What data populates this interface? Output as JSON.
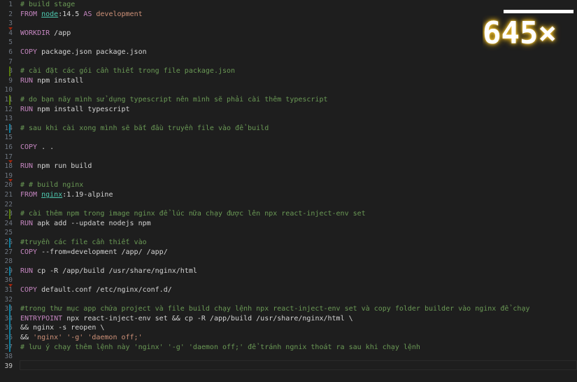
{
  "editor": {
    "lines": [
      {
        "n": "1",
        "parts": [
          {
            "t": "# build stage",
            "c": "comment"
          }
        ]
      },
      {
        "n": "2",
        "parts": [
          {
            "t": "FROM ",
            "c": "kw"
          },
          {
            "t": "node",
            "c": "img"
          },
          {
            "t": ":14.5 ",
            "c": "op"
          },
          {
            "t": "AS ",
            "c": "kw"
          },
          {
            "t": "development",
            "c": "str"
          }
        ]
      },
      {
        "n": "3",
        "parts": []
      },
      {
        "n": "4",
        "parts": [
          {
            "t": "WORKDIR ",
            "c": "kw"
          },
          {
            "t": "/app",
            "c": "op"
          }
        ]
      },
      {
        "n": "5",
        "parts": []
      },
      {
        "n": "6",
        "parts": [
          {
            "t": "COPY ",
            "c": "kw"
          },
          {
            "t": "package.json package.json",
            "c": "op"
          }
        ]
      },
      {
        "n": "7",
        "parts": []
      },
      {
        "n": "8",
        "parts": [
          {
            "t": "# cài đặt các gói cần thiết trong file package.json",
            "c": "comment"
          }
        ]
      },
      {
        "n": "9",
        "parts": [
          {
            "t": "RUN ",
            "c": "kw"
          },
          {
            "t": "npm install",
            "c": "op"
          }
        ]
      },
      {
        "n": "10",
        "parts": []
      },
      {
        "n": "11",
        "parts": [
          {
            "t": "# do bạn nãy mình sử dụng typescript nên mình sẽ phải cài thêm typescript",
            "c": "comment"
          }
        ]
      },
      {
        "n": "12",
        "parts": [
          {
            "t": "RUN ",
            "c": "kw"
          },
          {
            "t": "npm install typescript",
            "c": "op"
          }
        ]
      },
      {
        "n": "13",
        "parts": []
      },
      {
        "n": "14",
        "parts": [
          {
            "t": "# sau khi cài xong mình sẽ bắt đầu truyền file vào để build",
            "c": "comment"
          }
        ]
      },
      {
        "n": "15",
        "parts": []
      },
      {
        "n": "16",
        "parts": [
          {
            "t": "COPY ",
            "c": "kw"
          },
          {
            "t": ". .",
            "c": "op"
          }
        ]
      },
      {
        "n": "17",
        "parts": []
      },
      {
        "n": "18",
        "parts": [
          {
            "t": "RUN ",
            "c": "kw"
          },
          {
            "t": "npm run build",
            "c": "op"
          }
        ]
      },
      {
        "n": "19",
        "parts": []
      },
      {
        "n": "20",
        "parts": [
          {
            "t": "# # build nginx",
            "c": "comment"
          }
        ]
      },
      {
        "n": "21",
        "parts": [
          {
            "t": "FROM ",
            "c": "kw"
          },
          {
            "t": "nginx",
            "c": "img"
          },
          {
            "t": ":1.19-alpine",
            "c": "op"
          }
        ]
      },
      {
        "n": "22",
        "parts": []
      },
      {
        "n": "23",
        "parts": [
          {
            "t": "# cài thêm npm trong image nginx để lúc nữa chạy được lên npx react-inject-env set",
            "c": "comment"
          }
        ]
      },
      {
        "n": "24",
        "parts": [
          {
            "t": "RUN ",
            "c": "kw"
          },
          {
            "t": "apk add --update nodejs npm",
            "c": "op"
          }
        ]
      },
      {
        "n": "25",
        "parts": []
      },
      {
        "n": "26",
        "parts": [
          {
            "t": "#truyền các file cần thiết vào",
            "c": "comment"
          }
        ]
      },
      {
        "n": "27",
        "parts": [
          {
            "t": "COPY ",
            "c": "kw"
          },
          {
            "t": "--from=development /app/ /app/",
            "c": "op"
          }
        ]
      },
      {
        "n": "28",
        "parts": []
      },
      {
        "n": "29",
        "parts": [
          {
            "t": "RUN ",
            "c": "kw"
          },
          {
            "t": "cp -R /app/build /usr/share/nginx/html",
            "c": "op"
          }
        ]
      },
      {
        "n": "30",
        "parts": []
      },
      {
        "n": "31",
        "parts": [
          {
            "t": "COPY ",
            "c": "kw"
          },
          {
            "t": "default.conf /etc/nginx/conf.d/",
            "c": "op"
          }
        ]
      },
      {
        "n": "32",
        "parts": []
      },
      {
        "n": "33",
        "parts": [
          {
            "t": "#trong thư mục app chứa project và file build chạy lệnh npx react-inject-env set và copy folder builder vào nginx để chạy",
            "c": "comment"
          }
        ]
      },
      {
        "n": "34",
        "parts": [
          {
            "t": "ENTRYPOINT ",
            "c": "kw"
          },
          {
            "t": "npx react-inject-env set && cp -R /app/build /usr/share/nginx/html \\",
            "c": "op"
          }
        ]
      },
      {
        "n": "35",
        "parts": [
          {
            "t": "&& nginx -s reopen \\",
            "c": "op"
          }
        ]
      },
      {
        "n": "36",
        "parts": [
          {
            "t": "&& ",
            "c": "op"
          },
          {
            "t": "'nginx' '-g' 'daemon off;'",
            "c": "str"
          }
        ]
      },
      {
        "n": "37",
        "parts": [
          {
            "t": "# lưu ý chạy thêm lệnh này 'nginx' '-g' 'daemon off;' để tránh ngnix thoát ra sau khi chạy lệnh",
            "c": "comment"
          }
        ]
      },
      {
        "n": "38",
        "parts": []
      },
      {
        "n": "39",
        "parts": []
      }
    ],
    "active_line": "39"
  },
  "overlay": {
    "text": "645×"
  },
  "colors": {
    "background": "#1e1e1e",
    "comment": "#6a9955",
    "keyword": "#c586c0",
    "image": "#4ec9b0",
    "string": "#ce9178",
    "added_marker": "#587c0c",
    "modified_marker": "#0c7d9d",
    "deleted_marker": "#a1260d"
  }
}
